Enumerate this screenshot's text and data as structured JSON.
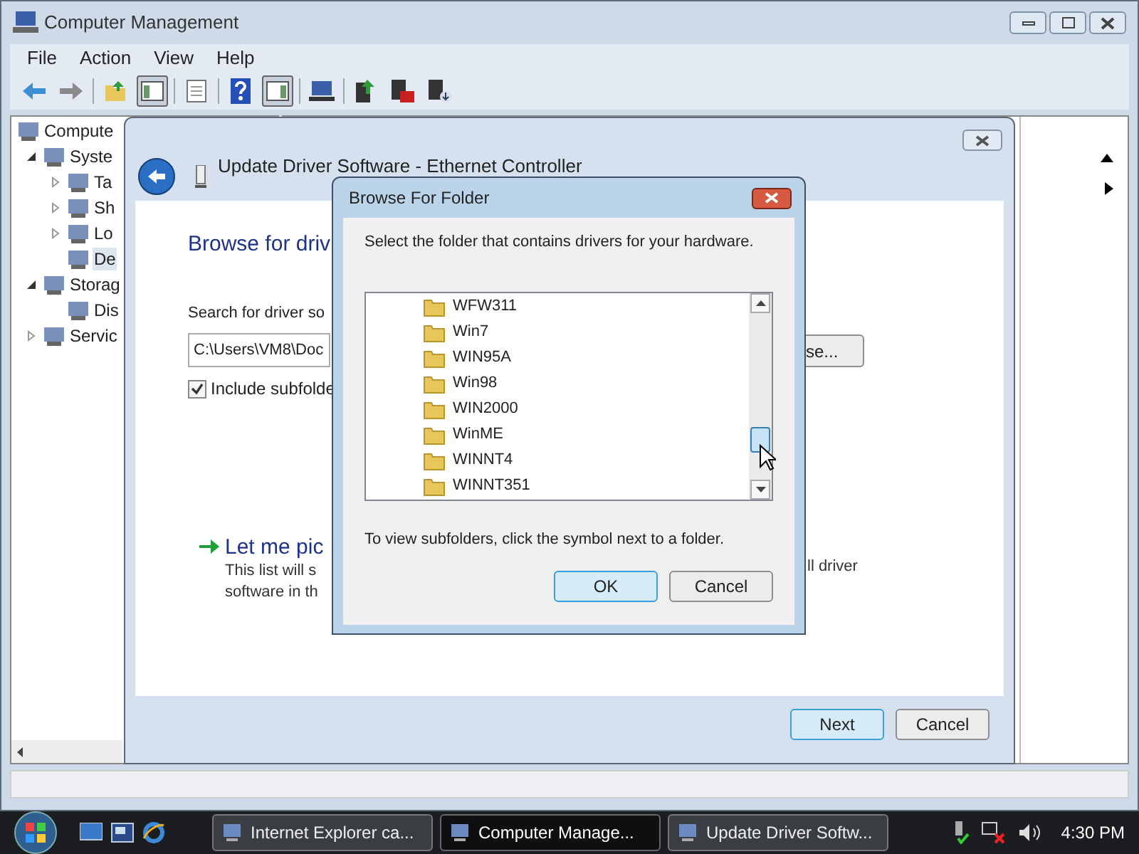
{
  "window": {
    "title": "Computer Management"
  },
  "menu": [
    "File",
    "Action",
    "View",
    "Help"
  ],
  "toolbar": [
    {
      "pressed": false
    },
    {
      "pressed": false
    },
    {
      "pressed": false
    },
    {
      "pressed": true
    },
    {
      "pressed": false
    },
    {
      "pressed": false
    },
    {
      "pressed": true
    },
    {
      "pressed": false
    },
    {
      "pressed": false
    },
    {
      "pressed": false
    },
    {
      "pressed": false
    }
  ],
  "tree": [
    {
      "label": "Compute",
      "kind": "root",
      "selected": false,
      "children": [
        {
          "label": "Syste",
          "kind": "branch",
          "expanded": true,
          "selected": false,
          "children": [
            {
              "label": "Ta",
              "kind": "branch",
              "expanded": false,
              "selected": false
            },
            {
              "label": "Sh",
              "kind": "branch",
              "expanded": false,
              "selected": false
            },
            {
              "label": "Lo",
              "kind": "branch",
              "expanded": false,
              "selected": false
            },
            {
              "label": "De",
              "kind": "leaf",
              "selected": true
            }
          ]
        },
        {
          "label": "Storag",
          "kind": "branch",
          "expanded": true,
          "selected": false,
          "children": [
            {
              "label": "Dis",
              "kind": "leaf",
              "selected": false
            }
          ]
        },
        {
          "label": "Servic",
          "kind": "branch",
          "expanded": false,
          "selected": false
        }
      ]
    }
  ],
  "wizard": {
    "title": "Update Driver Software - Ethernet Controller",
    "heading": "Browse for driv",
    "search_label": "Search for driver so",
    "path": "C:\\Users\\VM8\\Doc",
    "browse_button": "se...",
    "include_subfolders": {
      "label": "Include subfolde",
      "checked": true
    },
    "option": {
      "title": "Let me pic",
      "description": [
        "This list will s",
        "software in th"
      ],
      "description_right": "ll driver"
    },
    "buttons": {
      "next": "Next",
      "cancel": "Cancel"
    }
  },
  "dialog": {
    "title": "Browse For Folder",
    "instruction": "Select the folder that contains drivers for your hardware.",
    "folders": [
      {
        "name": "WFW311",
        "selected": false
      },
      {
        "name": "Win7",
        "selected": false
      },
      {
        "name": "WIN95A",
        "selected": false
      },
      {
        "name": "Win98",
        "selected": false
      },
      {
        "name": "WIN2000",
        "selected": false
      },
      {
        "name": "WinME",
        "selected": false
      },
      {
        "name": "WINNT4",
        "selected": false
      },
      {
        "name": "WINNT351",
        "selected": false
      }
    ],
    "hint": "To view subfolders, click the symbol next to a folder.",
    "buttons": {
      "ok": "OK",
      "cancel": "Cancel"
    }
  },
  "taskbar": {
    "tasks": [
      {
        "label": "Internet Explorer ca...",
        "selected": false
      },
      {
        "label": "Computer Manage...",
        "selected": true
      },
      {
        "label": "Update Driver Softw...",
        "selected": false
      }
    ],
    "clock": "4:30 PM"
  }
}
